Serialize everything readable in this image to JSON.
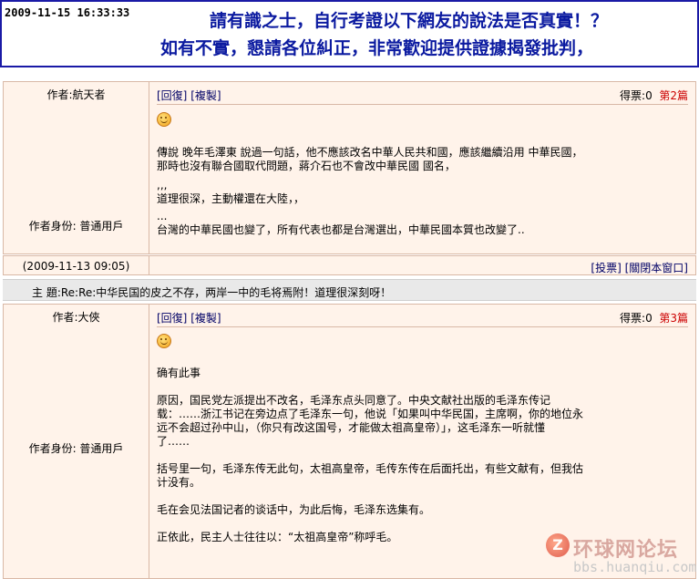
{
  "banner": {
    "timestamp": "2009-11-15 16:33:33",
    "line1": "請有識之士，自行考證以下網友的說法是否真實！？",
    "line2": "如有不實，懇請各位糾正，非常歡迎提供證據揭發批判，"
  },
  "posts": [
    {
      "author": "作者:航天者",
      "role": "作者身份: 普通用戶",
      "reply_label": "[回復]",
      "copy_label": "[複製]",
      "score_label": "得票:0",
      "floor_label": "第2篇",
      "paragraphs": [
        "傳說 晚年毛澤東 說過一句話，他不應該改名中華人民共和國，應該繼續沿用 中華民國，\n那時也沒有聯合國取代問題，蔣介石也不會改中華民國 國名，",
        ",,,\n道理很深，主動權還在大陸，，",
        "...\n台灣的中華民國也變了，所有代表也都是台灣選出，中華民國本質也改變了.."
      ]
    },
    {
      "author": "作者:大俠",
      "role": "作者身份: 普通用戶",
      "reply_label": "[回復]",
      "copy_label": "[複製]",
      "score_label": "得票:0",
      "floor_label": "第3篇",
      "paragraphs": [
        "确有此事",
        "原因，国民党左派提出不改名，毛泽东点头同意了。中央文献社出版的毛泽东传记\n载：……浙江书记在旁边点了毛泽东一句，他说「如果叫中华民国，主席啊，你的地位永\n远不会超过孙中山，（你只有改这国号，才能做太祖高皇帝）」，这毛泽东一听就懂\n了……",
        "括号里一句，毛泽东传无此句，太祖高皇帝，毛传东传在后面托出，有些文献有，但我估\n计没有。",
        "毛在会见法国记者的谈话中，为此后悔，毛泽东选集有。",
        "正依此，民主人士往往以：“太祖高皇帝”称呼毛。"
      ]
    }
  ],
  "footer": {
    "date": "(2009-11-13 09:05)",
    "vote_label": "[投票]",
    "close_label": "[關閉本窗口]"
  },
  "subject": {
    "text": "主 題:Re:Re:中华民国的皮之不存，两岸一中的毛将焉附！道理很深刻呀！"
  },
  "watermark": {
    "logo_glyph": "Z",
    "title": "环球网论坛",
    "url": "bbs.huanqiu.com"
  },
  "colors": {
    "banner_text": "#0b1aa0",
    "post_bg": "#fff3ea",
    "floor_red": "#cc0000"
  }
}
